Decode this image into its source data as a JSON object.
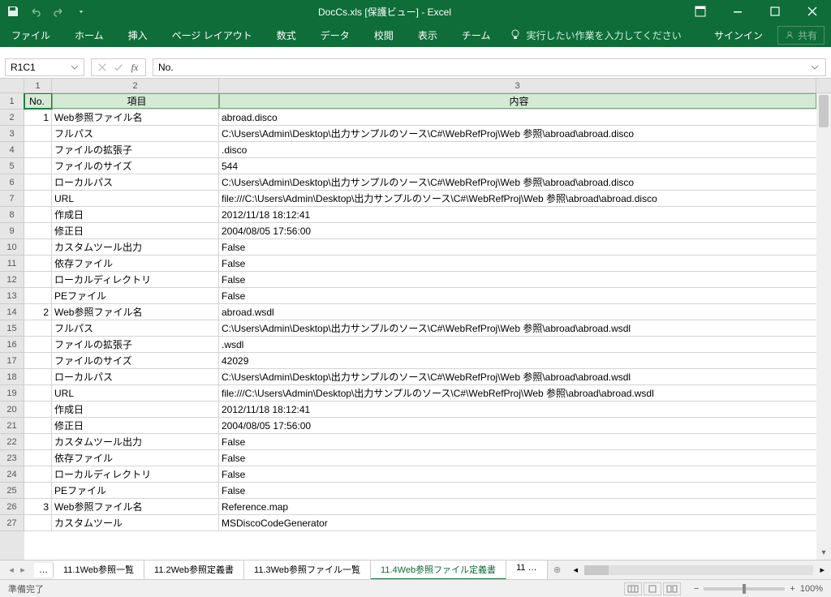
{
  "title": "DocCs.xls [保護ビュー] - Excel",
  "ribbon": {
    "tabs": [
      "ファイル",
      "ホーム",
      "挿入",
      "ページ レイアウト",
      "数式",
      "データ",
      "校閲",
      "表示",
      "チーム"
    ],
    "tellme": "実行したい作業を入力してください",
    "signin": "サインイン",
    "share": "共有"
  },
  "namebox": "R1C1",
  "formula": "No.",
  "colHeaders": [
    "1",
    "2",
    "3"
  ],
  "headerRow": {
    "no": "No.",
    "item": "項目",
    "content": "内容"
  },
  "rows": [
    {
      "n": "1",
      "no": "1",
      "item": "Web参照ファイル名",
      "content": "abroad.disco"
    },
    {
      "n": "2",
      "no": "",
      "item": "フルパス",
      "content": "C:\\Users\\Admin\\Desktop\\出力サンプルのソース\\C#\\WebRefProj\\Web 参照\\abroad\\abroad.disco"
    },
    {
      "n": "3",
      "no": "",
      "item": "ファイルの拡張子",
      "content": ".disco"
    },
    {
      "n": "4",
      "no": "",
      "item": "ファイルのサイズ",
      "content": "544"
    },
    {
      "n": "5",
      "no": "",
      "item": "ローカルパス",
      "content": "C:\\Users\\Admin\\Desktop\\出力サンプルのソース\\C#\\WebRefProj\\Web 参照\\abroad\\abroad.disco"
    },
    {
      "n": "6",
      "no": "",
      "item": "URL",
      "content": "file:///C:\\Users\\Admin\\Desktop\\出力サンプルのソース\\C#\\WebRefProj\\Web 参照\\abroad\\abroad.disco"
    },
    {
      "n": "7",
      "no": "",
      "item": "作成日",
      "content": "2012/11/18 18:12:41"
    },
    {
      "n": "8",
      "no": "",
      "item": "修正日",
      "content": "2004/08/05 17:56:00"
    },
    {
      "n": "9",
      "no": "",
      "item": "カスタムツール出力",
      "content": "False"
    },
    {
      "n": "10",
      "no": "",
      "item": "依存ファイル",
      "content": "False"
    },
    {
      "n": "11",
      "no": "",
      "item": "ローカルディレクトリ",
      "content": "False"
    },
    {
      "n": "12",
      "no": "",
      "item": "PEファイル",
      "content": "False"
    },
    {
      "n": "13",
      "no": "2",
      "item": "Web参照ファイル名",
      "content": "abroad.wsdl"
    },
    {
      "n": "14",
      "no": "",
      "item": "フルパス",
      "content": "C:\\Users\\Admin\\Desktop\\出力サンプルのソース\\C#\\WebRefProj\\Web 参照\\abroad\\abroad.wsdl"
    },
    {
      "n": "15",
      "no": "",
      "item": "ファイルの拡張子",
      "content": ".wsdl"
    },
    {
      "n": "16",
      "no": "",
      "item": "ファイルのサイズ",
      "content": "42029"
    },
    {
      "n": "17",
      "no": "",
      "item": "ローカルパス",
      "content": "C:\\Users\\Admin\\Desktop\\出力サンプルのソース\\C#\\WebRefProj\\Web 参照\\abroad\\abroad.wsdl"
    },
    {
      "n": "18",
      "no": "",
      "item": "URL",
      "content": "file:///C:\\Users\\Admin\\Desktop\\出力サンプルのソース\\C#\\WebRefProj\\Web 参照\\abroad\\abroad.wsdl"
    },
    {
      "n": "19",
      "no": "",
      "item": "作成日",
      "content": "2012/11/18 18:12:41"
    },
    {
      "n": "20",
      "no": "",
      "item": "修正日",
      "content": "2004/08/05 17:56:00"
    },
    {
      "n": "21",
      "no": "",
      "item": "カスタムツール出力",
      "content": "False"
    },
    {
      "n": "22",
      "no": "",
      "item": "依存ファイル",
      "content": "False"
    },
    {
      "n": "23",
      "no": "",
      "item": "ローカルディレクトリ",
      "content": "False"
    },
    {
      "n": "24",
      "no": "",
      "item": "PEファイル",
      "content": "False"
    },
    {
      "n": "25",
      "no": "3",
      "item": "Web参照ファイル名",
      "content": "Reference.map"
    },
    {
      "n": "26",
      "no": "",
      "item": "カスタムツール",
      "content": "MSDiscoCodeGenerator"
    }
  ],
  "sheets": {
    "dots": "…",
    "tabs": [
      "11.1Web参照一覧",
      "11.2Web参照定義書",
      "11.3Web参照ファイル一覧",
      "11.4Web参照ファイル定義書",
      "11 …"
    ],
    "activeIndex": 3
  },
  "status": {
    "ready": "準備完了",
    "zoom": "100%"
  }
}
